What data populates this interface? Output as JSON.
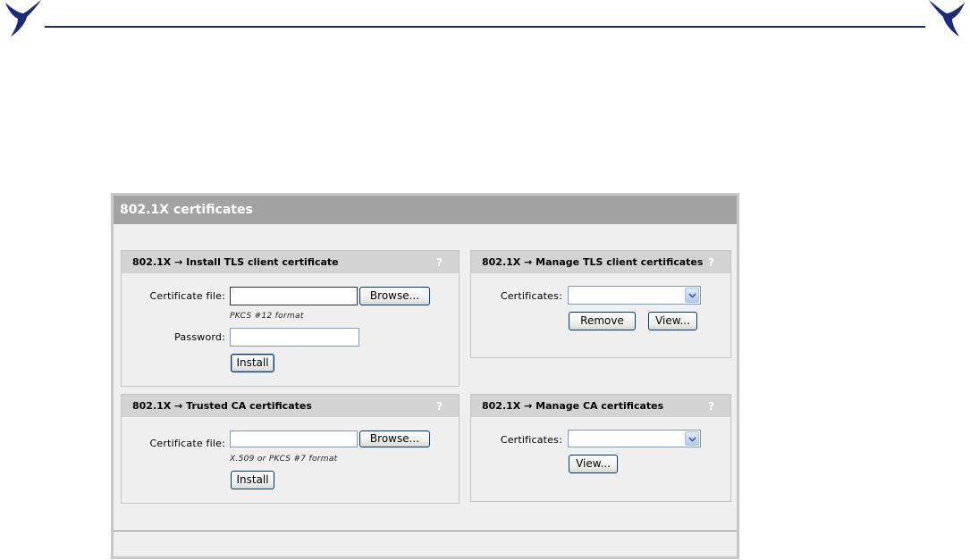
{
  "logo": {
    "icon": "swallow-bird-icon",
    "color": "#1b2a7a"
  },
  "page": {
    "title": "802.1X certificates",
    "accent_color": "#1b2a7a",
    "help_symbol": "?"
  },
  "install_tls": {
    "title": "802.1X → Install TLS client certificate",
    "cert_label": "Certificate file:",
    "cert_value": "",
    "browse_label": "Browse...",
    "format_hint": "PKCS #12 format",
    "password_label": "Password:",
    "password_value": "",
    "install_label": "Install"
  },
  "manage_tls": {
    "title": "802.1X → Manage TLS client certificates",
    "cert_label": "Certificates:",
    "selected": "",
    "remove_label": "Remove",
    "view_label": "View..."
  },
  "trusted_ca": {
    "title": "802.1X → Trusted CA certificates",
    "cert_label": "Certificate file:",
    "cert_value": "",
    "browse_label": "Browse...",
    "format_hint": "X.509 or PKCS #7 format",
    "install_label": "Install"
  },
  "manage_ca": {
    "title": "802.1X → Manage CA certificates",
    "cert_label": "Certificates:",
    "selected": "",
    "view_label": "View..."
  }
}
